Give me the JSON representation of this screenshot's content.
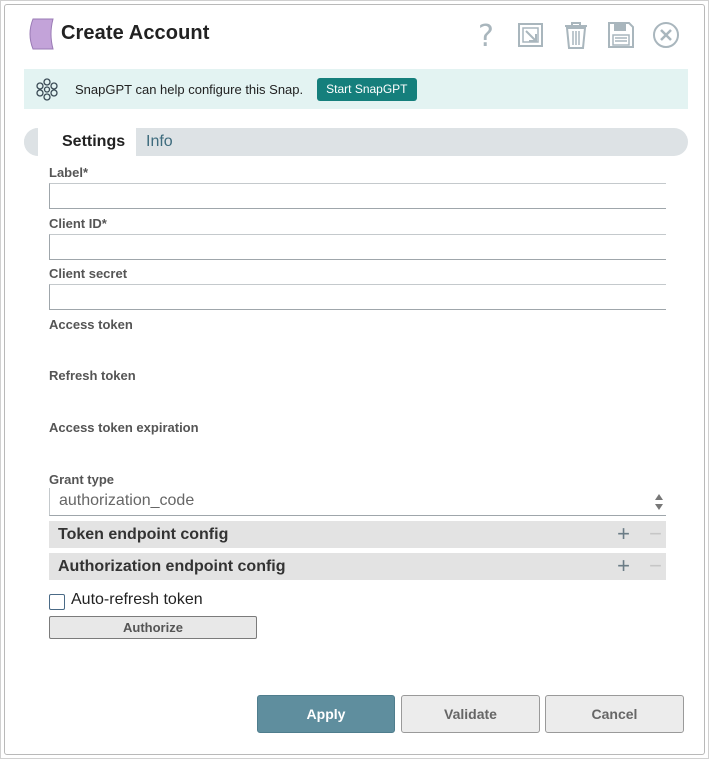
{
  "header": {
    "title": "Create Account",
    "icons": [
      "help-icon",
      "export-icon",
      "trash-icon",
      "save-icon",
      "close-icon"
    ]
  },
  "banner": {
    "text": "SnapGPT can help configure this Snap.",
    "button_label": "Start SnapGPT"
  },
  "tabs": [
    {
      "label": "Settings",
      "active": true
    },
    {
      "label": "Info",
      "active": false
    }
  ],
  "fields": {
    "label": {
      "label": "Label*",
      "value": ""
    },
    "client_id": {
      "label": "Client ID*",
      "value": ""
    },
    "client_secret": {
      "label": "Client secret",
      "value": ""
    },
    "access_token": {
      "label": "Access token"
    },
    "refresh_token": {
      "label": "Refresh token"
    },
    "access_token_expiration": {
      "label": "Access token expiration"
    },
    "grant_type": {
      "label": "Grant type",
      "value": "authorization_code"
    }
  },
  "sections": [
    {
      "label": "Token endpoint config",
      "plus": "+",
      "minus": "−"
    },
    {
      "label": "Authorization endpoint config",
      "plus": "+",
      "minus": "−"
    }
  ],
  "auto_refresh": {
    "label": "Auto-refresh token",
    "checked": false
  },
  "authorize_label": "Authorize",
  "footer": {
    "apply": "Apply",
    "validate": "Validate",
    "cancel": "Cancel"
  },
  "colors": {
    "accent": "#157f7c",
    "apply": "#5f8e9e",
    "banner_bg": "#e3f3f2",
    "snap_icon": "#c3a3d9"
  }
}
